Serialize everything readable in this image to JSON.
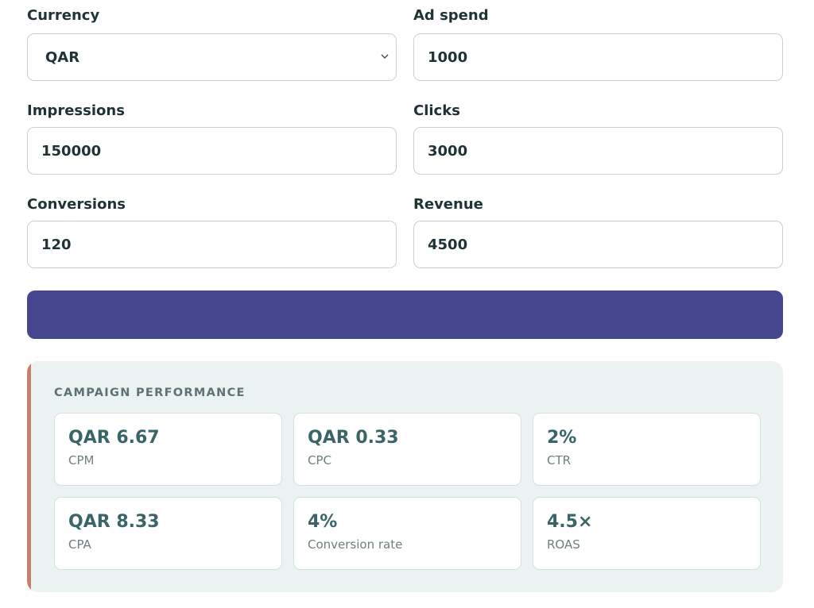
{
  "form": {
    "currency": {
      "label": "Currency",
      "value": "QAR"
    },
    "ad_spend": {
      "label": "Ad spend",
      "value": "1000"
    },
    "impressions": {
      "label": "Impressions",
      "value": "150000"
    },
    "clicks": {
      "label": "Clicks",
      "value": "3000"
    },
    "conversions": {
      "label": "Conversions",
      "value": "120"
    },
    "revenue": {
      "label": "Revenue",
      "value": "4500"
    }
  },
  "results": {
    "title": "CAMPAIGN PERFORMANCE",
    "metrics": [
      {
        "value": "QAR 6.67",
        "label": "CPM"
      },
      {
        "value": "QAR 0.33",
        "label": "CPC"
      },
      {
        "value": "2%",
        "label": "CTR"
      },
      {
        "value": "QAR 8.33",
        "label": "CPA"
      },
      {
        "value": "4%",
        "label": "Conversion rate"
      },
      {
        "value": "4.5×",
        "label": "ROAS"
      }
    ]
  },
  "colors": {
    "button": "#46468e",
    "panel_bg": "#ebf2f2",
    "accent": "#c97d6c",
    "metric_value": "#3a6568"
  },
  "icons": {
    "select_chevron": "chevron-down-icon"
  }
}
